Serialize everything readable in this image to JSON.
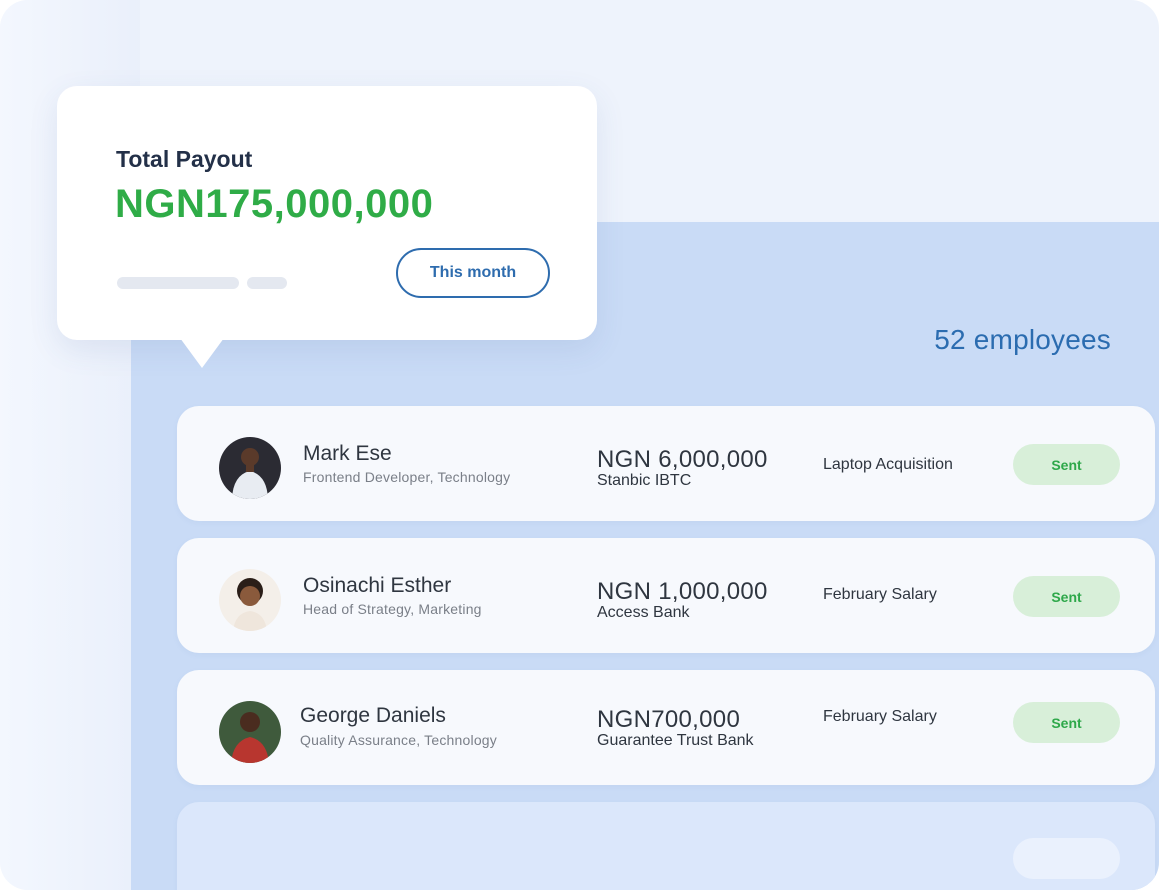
{
  "summary": {
    "title": "Total Payout",
    "amount": "NGN175,000,000",
    "filter_label": "This month"
  },
  "employee_count": "52 employees",
  "payments": [
    {
      "name": "Mark Ese",
      "role": "Frontend Developer, Technology",
      "amount": "NGN 6,000,000",
      "bank": "Stanbic IBTC",
      "purpose": "Laptop Acquisition",
      "status": "Sent"
    },
    {
      "name": "Osinachi Esther",
      "role": "Head of Strategy, Marketing",
      "amount": "NGN 1,000,000",
      "bank": "Access Bank",
      "purpose": "February Salary",
      "status": "Sent"
    },
    {
      "name": "George Daniels",
      "role": "Quality Assurance, Technology",
      "amount": "NGN700,000",
      "bank": "Guarantee Trust Bank",
      "purpose": "February Salary",
      "status": "Sent"
    }
  ],
  "colors": {
    "accent_green": "#2fac47",
    "accent_blue": "#2e6cae",
    "status_bg": "#d8efd9"
  }
}
